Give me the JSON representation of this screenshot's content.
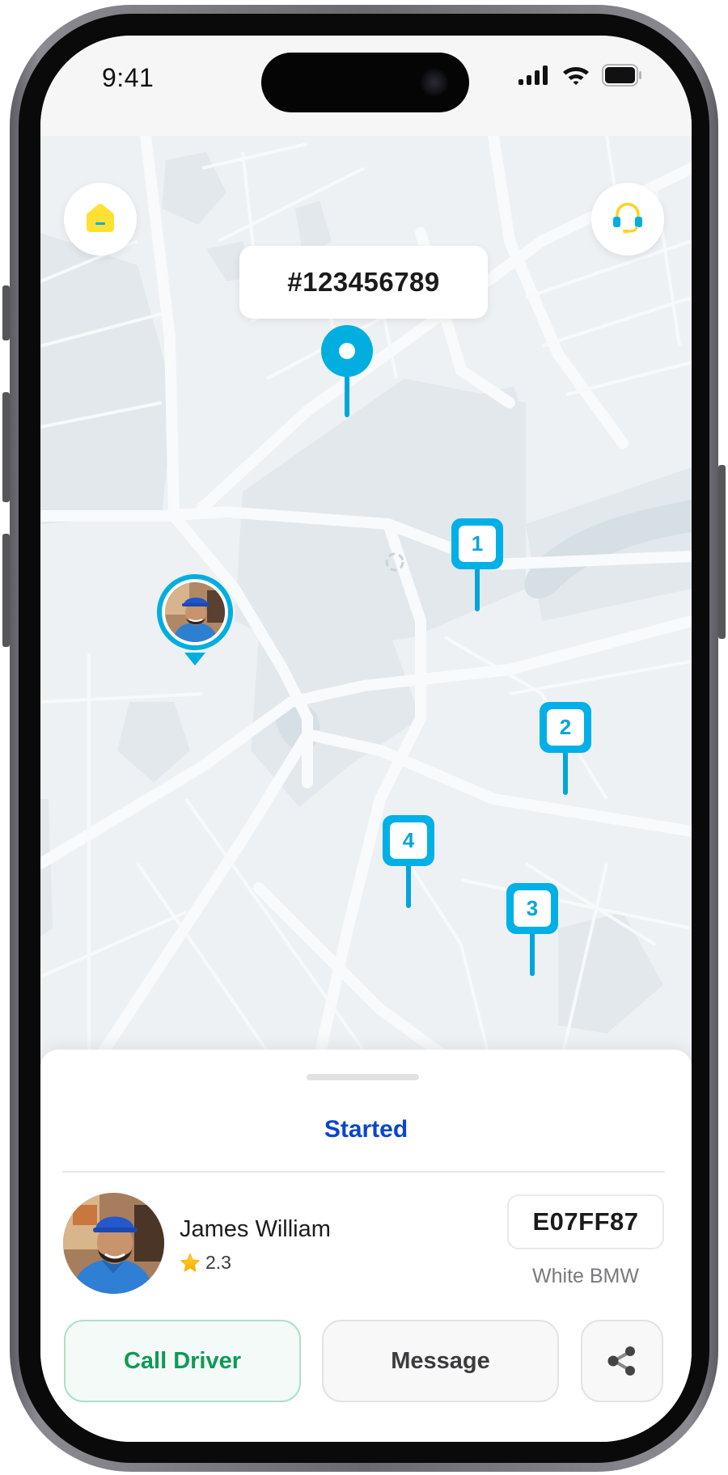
{
  "status_bar": {
    "time": "9:41",
    "icons": [
      "cellular-signal-icon",
      "wifi-icon",
      "battery-icon"
    ]
  },
  "map": {
    "home_button_icon": "home-icon",
    "order_id": "#123456789",
    "support_button_icon": "headset-support-icon",
    "destination_pin_icon": "location-pin-icon",
    "driver_marker_icon": "driver-avatar-marker",
    "stops": [
      {
        "label": "1"
      },
      {
        "label": "2"
      },
      {
        "label": "3"
      },
      {
        "label": "4"
      }
    ]
  },
  "sheet": {
    "status": "Started",
    "driver": {
      "name": "James William",
      "rating": "2.3",
      "rating_icon": "star-icon"
    },
    "vehicle": {
      "plate": "E07FF87",
      "description": "White BMW"
    },
    "actions": {
      "call_label": "Call Driver",
      "message_label": "Message",
      "share_icon": "share-icon"
    }
  },
  "colors": {
    "accent": "#00aee0",
    "status_blue": "#0b46c8",
    "call_green": "#0e9a56",
    "home_yellow": "#ffe033"
  }
}
